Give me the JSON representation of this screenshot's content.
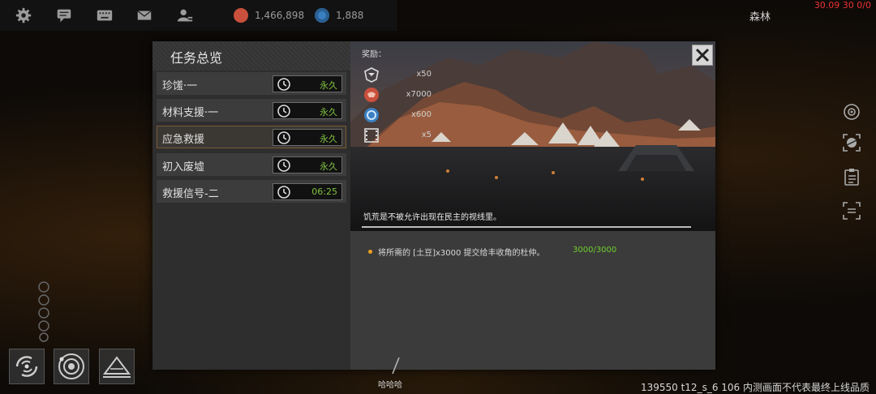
{
  "topbar": {
    "icons": [
      "gear-icon",
      "chat-icon",
      "keyboard-icon",
      "mail-icon",
      "profile-icon"
    ],
    "resource1": {
      "icon": "red-resource-icon",
      "value": "1,466,898",
      "color": "#c9503c"
    },
    "resource2": {
      "icon": "blue-resource-icon",
      "value": "1,888",
      "color": "#3a7fc2"
    },
    "player_name": "森林",
    "status_text": "30.09 30 0/0"
  },
  "modal": {
    "title": "任务总览",
    "tasks": [
      {
        "label": "珍馐·一",
        "timer": "永久",
        "selected": false
      },
      {
        "label": "材料支援·一",
        "timer": "永久",
        "selected": false
      },
      {
        "label": "应急救援",
        "timer": "永久",
        "selected": true
      },
      {
        "label": "初入废墟",
        "timer": "永久",
        "selected": false
      },
      {
        "label": "救援信号-二",
        "timer": "06:25",
        "selected": false
      }
    ],
    "reward_title": "奖励：",
    "rewards": [
      {
        "icon": "rank-badge-icon",
        "count": "x50"
      },
      {
        "icon": "red-resource-icon",
        "count": "x7000"
      },
      {
        "icon": "blue-resource-icon",
        "count": "x600"
      },
      {
        "icon": "film-icon",
        "count": "x5"
      }
    ],
    "story": "饥荒是不被允许出现在民主的视线里。",
    "objective": "将所需的 [土豆]x3000 提交给丰收角的杜仲。",
    "objective_progress": "3000/3000",
    "close_icon": "close-icon"
  },
  "side_icons": [
    "target-icon",
    "planet-scan-icon",
    "clipboard-icon",
    "scan-frame-icon"
  ],
  "bottom_buttons": [
    "galaxy-icon",
    "orbit-icon",
    "terrain-icon"
  ],
  "chat_label": "哈哈哈",
  "watermark": "139550 t12_s_6 106  内测画面不代表最终上线品质",
  "colors": {
    "accent_green": "#6fcf2a",
    "selection_border": "#7a5a35",
    "bullet": "#f0a020"
  }
}
